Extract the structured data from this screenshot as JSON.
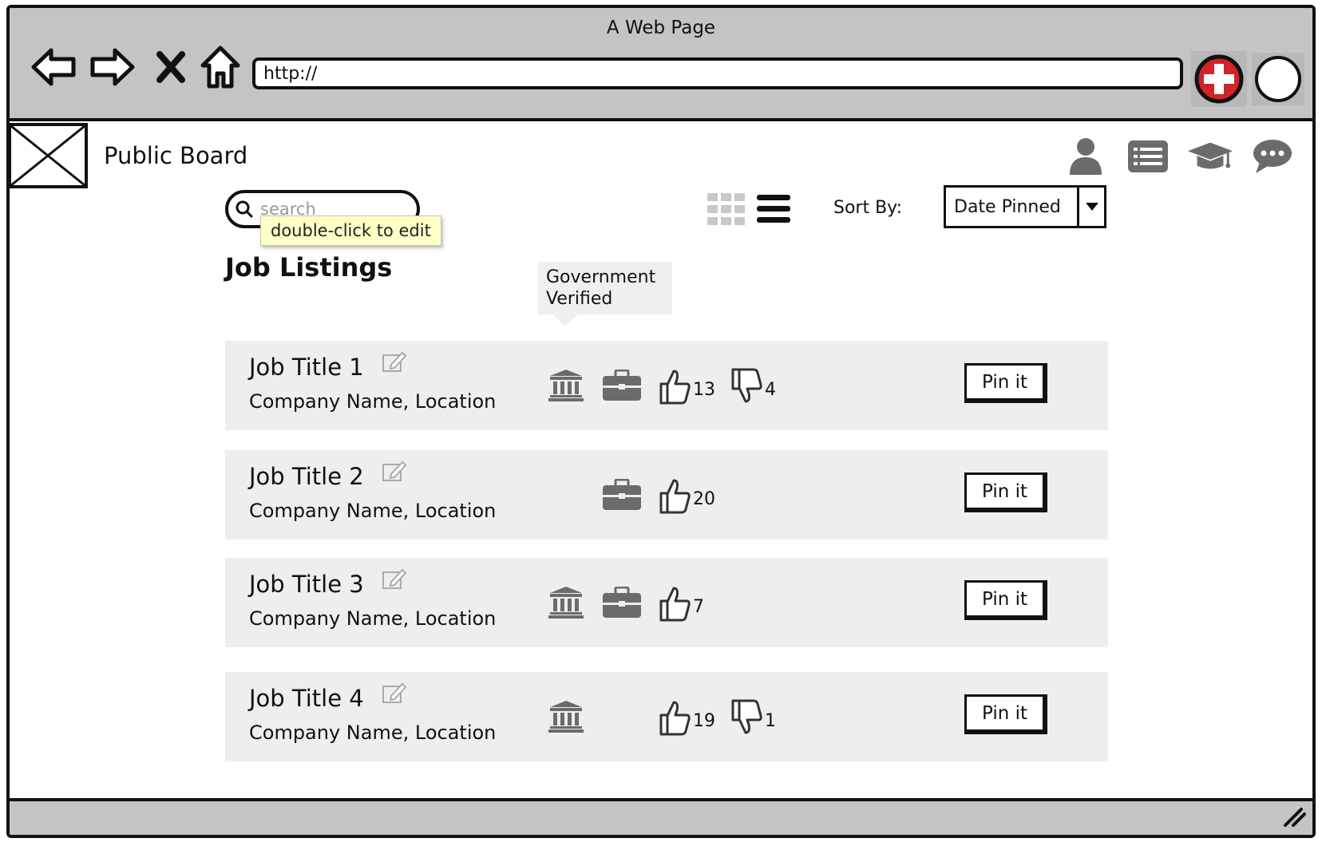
{
  "browser": {
    "window_title": "A Web Page",
    "url": "http://"
  },
  "page": {
    "site_title": "Public Board",
    "search": {
      "placeholder": "search"
    },
    "tooltip": "double-click to edit",
    "sort": {
      "label": "Sort By:",
      "value": "Date Pinned"
    },
    "section_title": "Job Listings",
    "callout": "Government Verified",
    "top_icons": [
      "user-icon",
      "list-icon",
      "graduation-cap-icon",
      "chat-icon"
    ]
  },
  "jobs": [
    {
      "title": "Job Title 1",
      "company": "Company Name, Location",
      "government": true,
      "briefcase": true,
      "likes": "13",
      "dislikes": "4",
      "pin_label": "Pin it"
    },
    {
      "title": "Job Title 2",
      "company": "Company Name, Location",
      "government": false,
      "briefcase": true,
      "likes": "20",
      "dislikes": null,
      "pin_label": "Pin it"
    },
    {
      "title": "Job Title 3",
      "company": "Company Name, Location",
      "government": true,
      "briefcase": true,
      "likes": "7",
      "dislikes": null,
      "pin_label": "Pin it"
    },
    {
      "title": "Job Title 4",
      "company": "Company Name, Location",
      "government": true,
      "briefcase": false,
      "likes": "19",
      "dislikes": "1",
      "pin_label": "Pin it"
    }
  ],
  "colors": {
    "chrome": "#c4c4c4",
    "row_background": "#eeeeee",
    "icon_gray": "#6b6b6b",
    "add_button_red": "#d0232a",
    "tooltip_yellow": "#ffffc8"
  }
}
